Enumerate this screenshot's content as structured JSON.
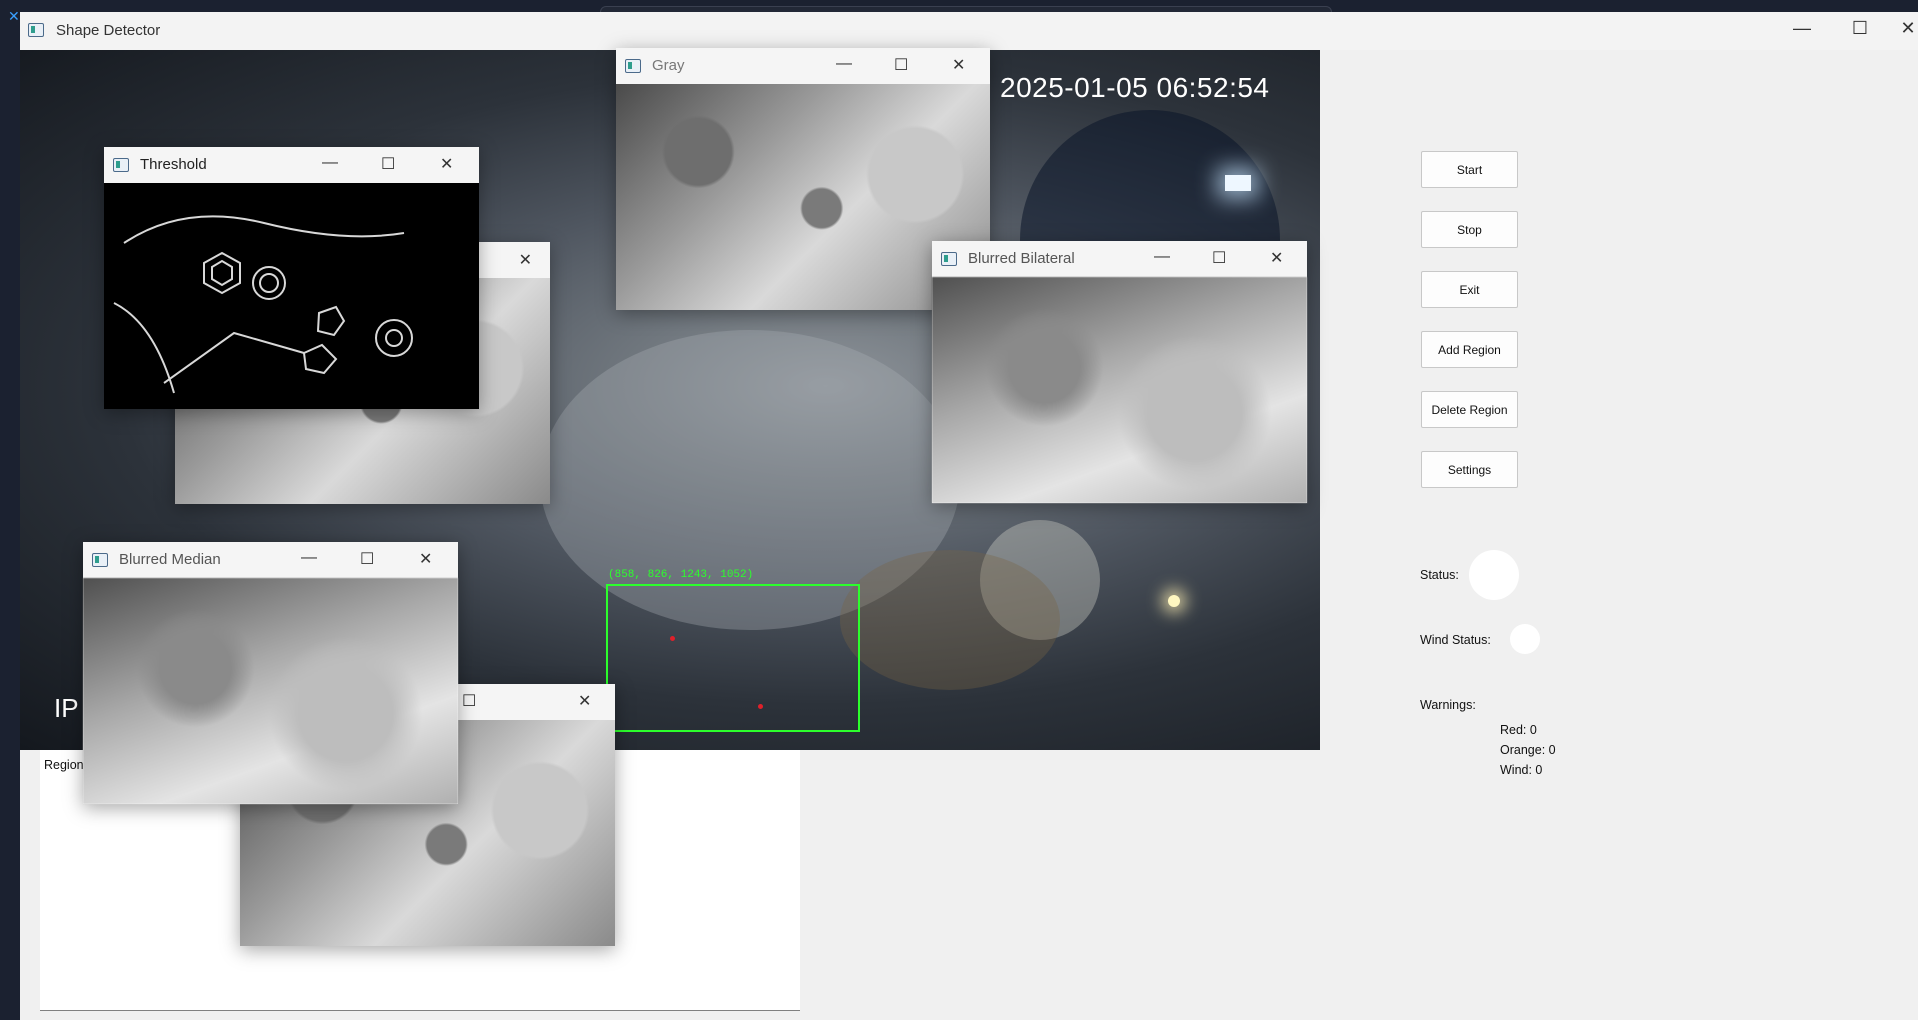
{
  "window": {
    "title": "Shape Detector",
    "controls": {
      "minimize": "—",
      "maximize": "☐",
      "close": "✕"
    }
  },
  "video": {
    "timestamp": "2025-01-05 06:52:54",
    "roi_label": "(858, 826, 1243, 1052)",
    "overlay_text": "IP"
  },
  "subwindows": {
    "gray": {
      "title": "Gray"
    },
    "threshold": {
      "title": "Threshold"
    },
    "blurred_bilateral": {
      "title": "Blurred Bilateral"
    },
    "blurred_median": {
      "title": "Blurred Median"
    }
  },
  "controls": {
    "buttons": [
      "Start",
      "Stop",
      "Exit",
      "Add Region",
      "Delete Region",
      "Settings"
    ],
    "status_label": "Status:",
    "wind_status_label": "Wind Status:",
    "warnings_label": "Warnings:",
    "warnings": {
      "red": "Red: 0",
      "orange": "Orange: 0",
      "wind": "Wind: 0"
    }
  },
  "region_panel": {
    "label": "Region"
  },
  "colors": {
    "roi": "#2cff2c",
    "marker": "#e0202a"
  }
}
